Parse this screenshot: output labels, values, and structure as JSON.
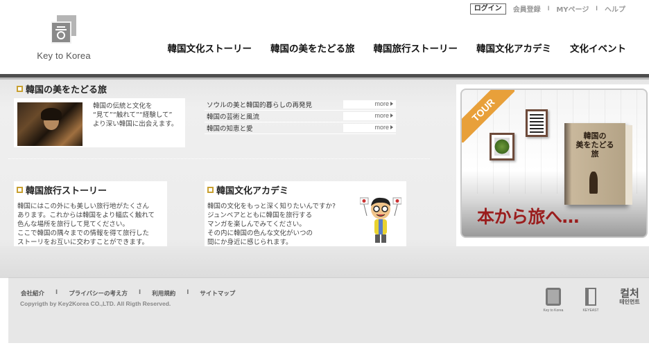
{
  "header": {
    "logo_text": "Key to Korea",
    "util": {
      "login": "ログイン",
      "register": "会員登録",
      "mypage": "MYページ",
      "help": "ヘルプ",
      "separator": "I"
    },
    "nav": [
      {
        "label": "韓国文化ストーリー"
      },
      {
        "label": "韓国の美をたどる旅"
      },
      {
        "label": "韓国旅行ストーリー"
      },
      {
        "label": "韓国文化アカデミ"
      },
      {
        "label": "文化イベント"
      }
    ]
  },
  "main": {
    "travel": {
      "title": "韓国の美をたどる旅",
      "description": "韓国の伝統と文化を\n“見て”“触れて”“経験して”\nより深い韓国に出会えます。",
      "links": [
        {
          "label": "ソウルの美と韓国的暮らしの再発見",
          "more": "more"
        },
        {
          "label": "韓国の芸術と風流",
          "more": "more"
        },
        {
          "label": "韓国の知恵と愛",
          "more": "more"
        }
      ]
    },
    "story": {
      "title": "韓国旅行ストーリー",
      "description": "韓国にはこの外にも美しい旅行地がたくさん\nあります。これからは韓国をより幅広く触れて\n色んな場所を旅行して見てください。\nここで韓国の隅々までの情報を得て旅行した\nストーリをお互いに交わすことができます。"
    },
    "academy": {
      "title": "韓国文化アカデミ",
      "description": "韓国の文化をもっと深く知りたいんですか?\nジュンベアとともに韓国を旅行する\nマンガを楽しんでみてください。\nその内に韓国の色んな文化がいつの\n間にか身近に感じられます。"
    },
    "banner": {
      "ribbon": "TOUR",
      "book_title": "韓国の\n美をたどる\n旅",
      "caption": "本から旅へ…"
    }
  },
  "footer": {
    "links": [
      {
        "label": "会社紹介"
      },
      {
        "label": "プライバシーの考え方"
      },
      {
        "label": "利用規約"
      },
      {
        "label": "サイトマップ"
      }
    ],
    "separator": "I",
    "copyright": "Copyrigth by Key2Korea CO.,LTD.  All Rigth Reserved.",
    "partner_logos": {
      "key_to_korea": "Key to Korea",
      "keyeast": "KEYEAST",
      "culture_top": "컬처",
      "culture_bottom": "테인먼트"
    }
  },
  "colors": {
    "accent_bullet": "#c8a030",
    "banner_caption": "#9a1d1d",
    "ribbon": "#e8a03a",
    "header_bar": "#4d4d4d"
  }
}
